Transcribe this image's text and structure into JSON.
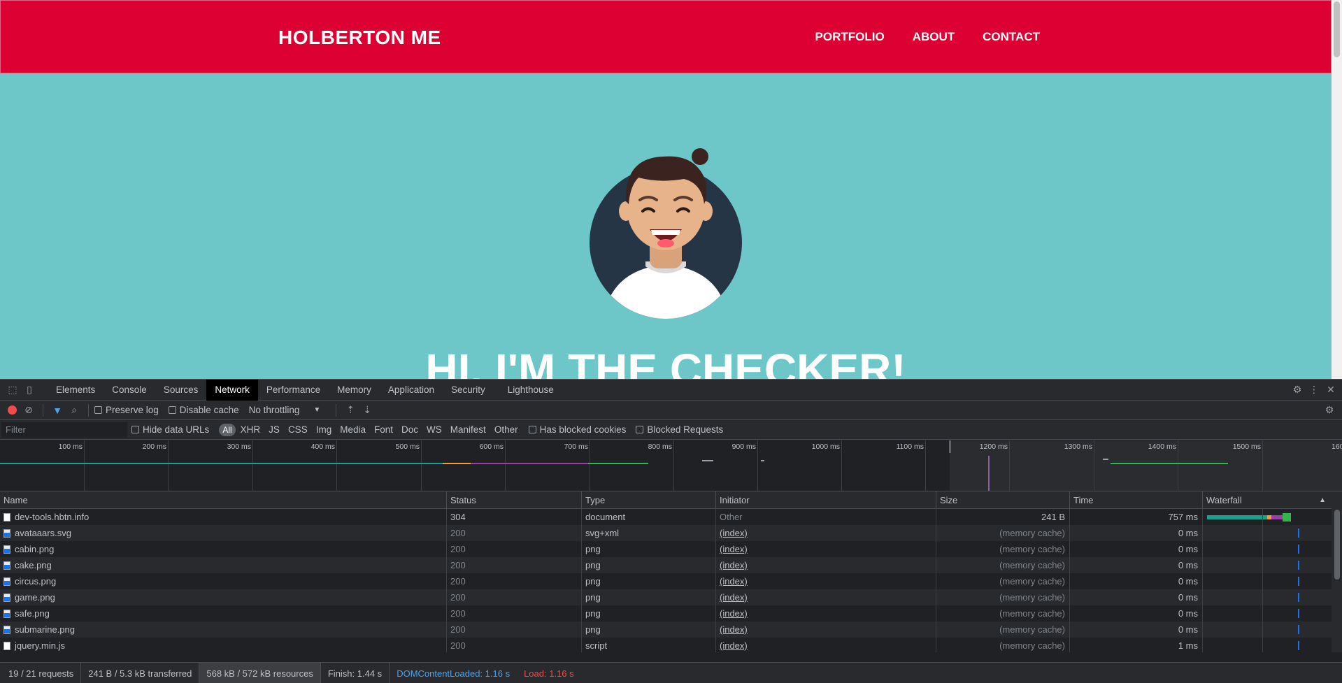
{
  "site": {
    "brand": "HOLBERTON ME",
    "nav": [
      "PORTFOLIO",
      "ABOUT",
      "CONTACT"
    ],
    "hero_title": "HI, I'M THE CHECKER!",
    "colors": {
      "header": "#dc0033",
      "hero": "#6dc7c9"
    }
  },
  "devtools": {
    "tabs": [
      "Elements",
      "Console",
      "Sources",
      "Network",
      "Performance",
      "Memory",
      "Application",
      "Security",
      "Lighthouse"
    ],
    "active_tab": "Network",
    "toolbar": {
      "preserve_log": "Preserve log",
      "disable_cache": "Disable cache",
      "throttling": "No throttling"
    },
    "filter": {
      "placeholder": "Filter",
      "hide_data_urls": "Hide data URLs",
      "types": [
        "All",
        "XHR",
        "JS",
        "CSS",
        "Img",
        "Media",
        "Font",
        "Doc",
        "WS",
        "Manifest",
        "Other"
      ],
      "has_blocked_cookies": "Has blocked cookies",
      "blocked_requests": "Blocked Requests"
    },
    "overview_ticks": [
      "100 ms",
      "200 ms",
      "300 ms",
      "400 ms",
      "500 ms",
      "600 ms",
      "700 ms",
      "800 ms",
      "900 ms",
      "1000 ms",
      "1100 ms",
      "1200 ms",
      "1300 ms",
      "1400 ms",
      "1500 ms",
      "160"
    ],
    "columns": [
      "Name",
      "Status",
      "Type",
      "Initiator",
      "Size",
      "Time",
      "Waterfall"
    ],
    "rows": [
      {
        "name": "dev-tools.hbtn.info",
        "status": "304",
        "type": "document",
        "initiator": "Other",
        "size": "241 B",
        "time": "757 ms",
        "icon": "doc"
      },
      {
        "name": "avataaars.svg",
        "status": "200",
        "type": "svg+xml",
        "initiator": "(index)",
        "size": "(memory cache)",
        "time": "0 ms",
        "icon": "img"
      },
      {
        "name": "cabin.png",
        "status": "200",
        "type": "png",
        "initiator": "(index)",
        "size": "(memory cache)",
        "time": "0 ms",
        "icon": "img"
      },
      {
        "name": "cake.png",
        "status": "200",
        "type": "png",
        "initiator": "(index)",
        "size": "(memory cache)",
        "time": "0 ms",
        "icon": "img"
      },
      {
        "name": "circus.png",
        "status": "200",
        "type": "png",
        "initiator": "(index)",
        "size": "(memory cache)",
        "time": "0 ms",
        "icon": "img"
      },
      {
        "name": "game.png",
        "status": "200",
        "type": "png",
        "initiator": "(index)",
        "size": "(memory cache)",
        "time": "0 ms",
        "icon": "img"
      },
      {
        "name": "safe.png",
        "status": "200",
        "type": "png",
        "initiator": "(index)",
        "size": "(memory cache)",
        "time": "0 ms",
        "icon": "img"
      },
      {
        "name": "submarine.png",
        "status": "200",
        "type": "png",
        "initiator": "(index)",
        "size": "(memory cache)",
        "time": "0 ms",
        "icon": "img"
      },
      {
        "name": "jquery.min.js",
        "status": "200",
        "type": "script",
        "initiator": "(index)",
        "size": "(memory cache)",
        "time": "1 ms",
        "icon": "doc"
      }
    ],
    "status": {
      "requests": "19 / 21 requests",
      "transferred": "241 B / 5.3 kB transferred",
      "resources": "568 kB / 572 kB resources",
      "finish": "Finish: 1.44 s",
      "dom_content_loaded": "DOMContentLoaded: 1.16 s",
      "load": "Load: 1.16 s"
    },
    "colors": {
      "dcl": "#4aa3f3",
      "load": "#f14b4b",
      "record": "#f14b4b"
    }
  }
}
